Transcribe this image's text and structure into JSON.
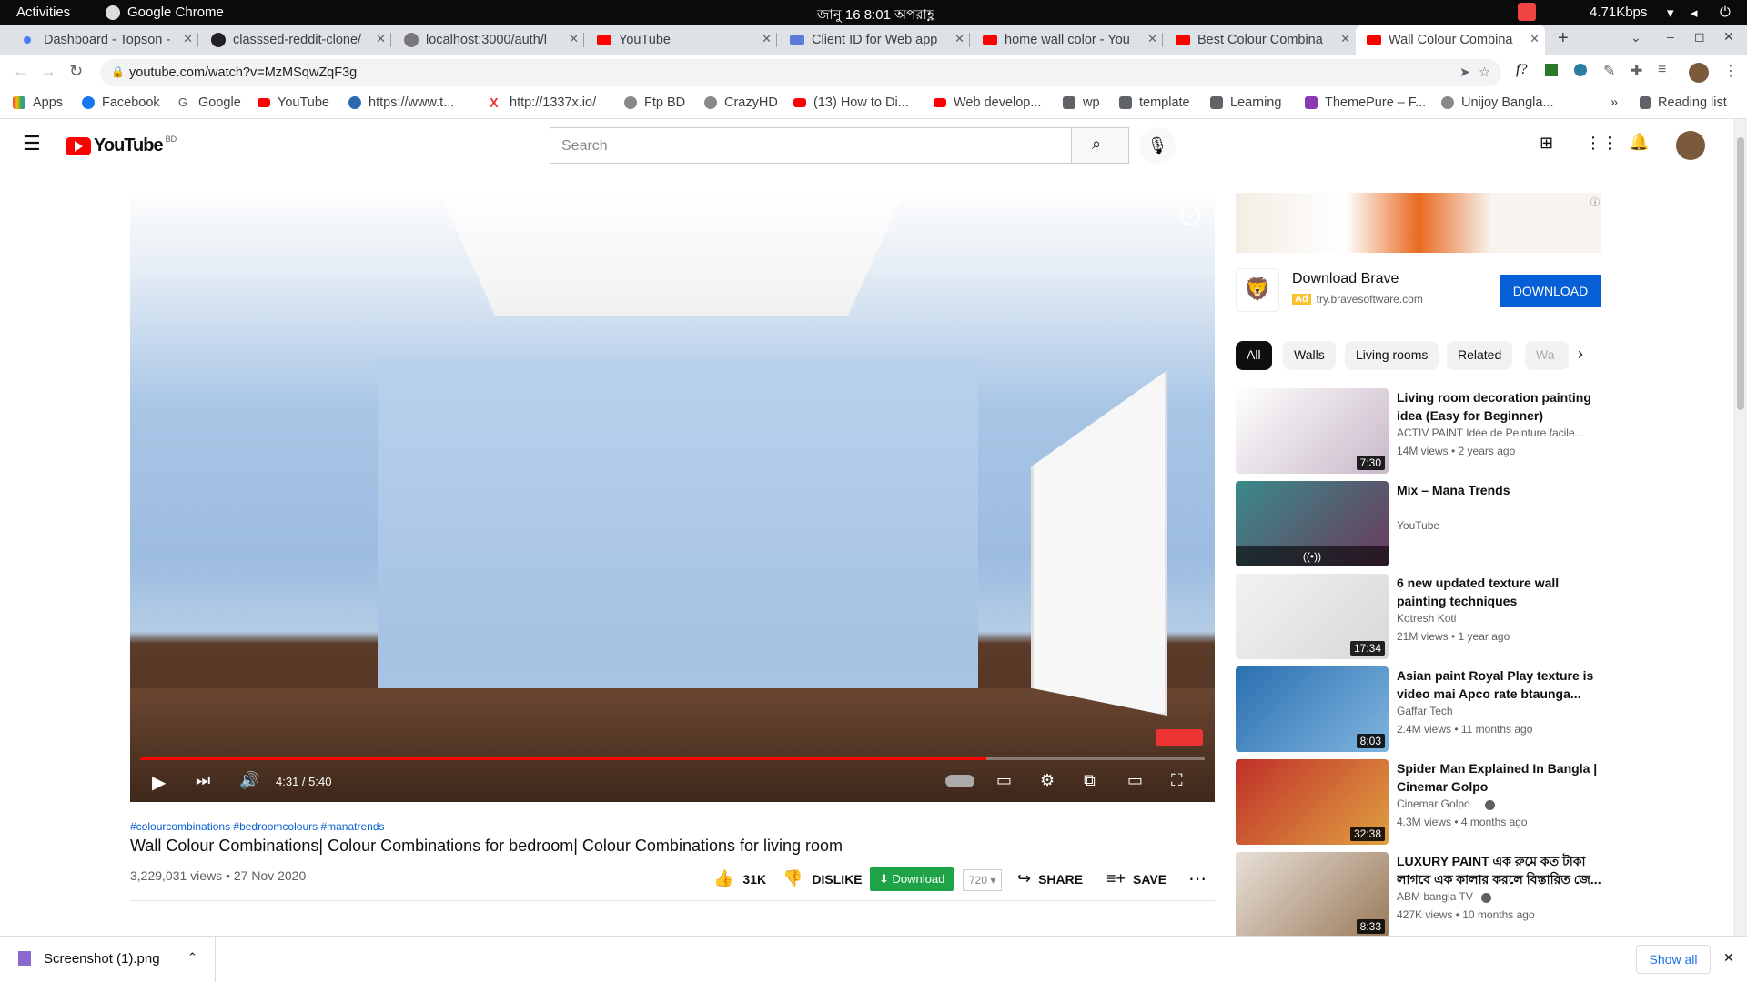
{
  "os": {
    "activities": "Activities",
    "app": "Google Chrome",
    "clock": "জানু 16  8:01 অপরাহ্ণ",
    "net": "4.71Kbps"
  },
  "tabs": [
    {
      "title": "Dashboard - Topson -"
    },
    {
      "title": "classsed-reddit-clone/"
    },
    {
      "title": "localhost:3000/auth/l"
    },
    {
      "title": "YouTube"
    },
    {
      "title": "Client ID for Web app"
    },
    {
      "title": "home wall color - You"
    },
    {
      "title": "Best Colour Combina"
    },
    {
      "title": "Wall Colour Combina"
    }
  ],
  "address": {
    "url": "youtube.com/watch?v=MzMSqwZqF3g"
  },
  "bookmarks": [
    "Apps",
    "Facebook",
    "Google",
    "YouTube",
    "https://www.t...",
    "http://1337x.io/",
    "Ftp BD",
    "CrazyHD",
    "(13) How to Di...",
    "Web develop...",
    "wp",
    "template",
    "Learning",
    "ThemePure – F...",
    "Unijoy Bangla..."
  ],
  "reading_list": "Reading list",
  "yt": {
    "logo": "YouTube",
    "region": "BD",
    "search_placeholder": "Search"
  },
  "player": {
    "time": "4:31 / 5:40",
    "progress": 0.795
  },
  "video": {
    "hashtags": "#colourcombinations #bedroomcolours #manatrends",
    "title": "Wall Colour Combinations| Colour Combinations for bedroom| Colour Combinations for living room",
    "stats": "3,229,031 views • 27 Nov 2020",
    "likes": "31K",
    "dislike": "DISLIKE",
    "download": "Download",
    "quality": "720",
    "share": "SHARE",
    "save": "SAVE"
  },
  "ad": {
    "title": "Download Brave",
    "badge": "Ad",
    "domain": "try.bravesoftware.com",
    "cta": "DOWNLOAD"
  },
  "chips": [
    "All",
    "Walls",
    "Living rooms",
    "Related",
    "Wa"
  ],
  "recs": [
    {
      "title": "Living room decoration painting idea (Easy for Beginner)",
      "channel": "ACTIV PAINT Idée de Peinture facile...",
      "stats": "14M views • 2 years ago",
      "dur": "7:30",
      "c1": "#ffffff",
      "c2": "#c8b8c8"
    },
    {
      "title": "Mix – Mana Trends",
      "channel": "YouTube",
      "stats": "",
      "dur": "",
      "c1": "#3a8a8a",
      "c2": "#6b3a5c"
    },
    {
      "title": "6 new updated texture wall painting techniques",
      "channel": "Kotresh Koti",
      "stats": "21M views • 1 year ago",
      "dur": "17:34",
      "c1": "#f2f2f2",
      "c2": "#d8d8d8"
    },
    {
      "title": "Asian paint Royal Play texture is video mai Apco rate btaunga...",
      "channel": "Gaffar Tech",
      "stats": "2.4M views • 11 months ago",
      "dur": "8:03",
      "c1": "#2a6fb0",
      "c2": "#7fb4de"
    },
    {
      "title": "Spider Man Explained In Bangla | Cinemar Golpo",
      "channel": "Cinemar Golpo",
      "stats": "4.3M views • 4 months ago",
      "dur": "32:38",
      "c1": "#c0302a",
      "c2": "#e0a040"
    },
    {
      "title": "LUXURY PAINT এক রুমে কত টাকা লাগবে এক কালার করলে বিস্তারিত জে...",
      "channel": "ABM bangla TV",
      "stats": "427K views • 10 months ago",
      "dur": "8:33",
      "c1": "#e8e0d8",
      "c2": "#9a7a5a"
    }
  ],
  "downloads": {
    "file": "Screenshot (1).png",
    "show_all": "Show all"
  }
}
